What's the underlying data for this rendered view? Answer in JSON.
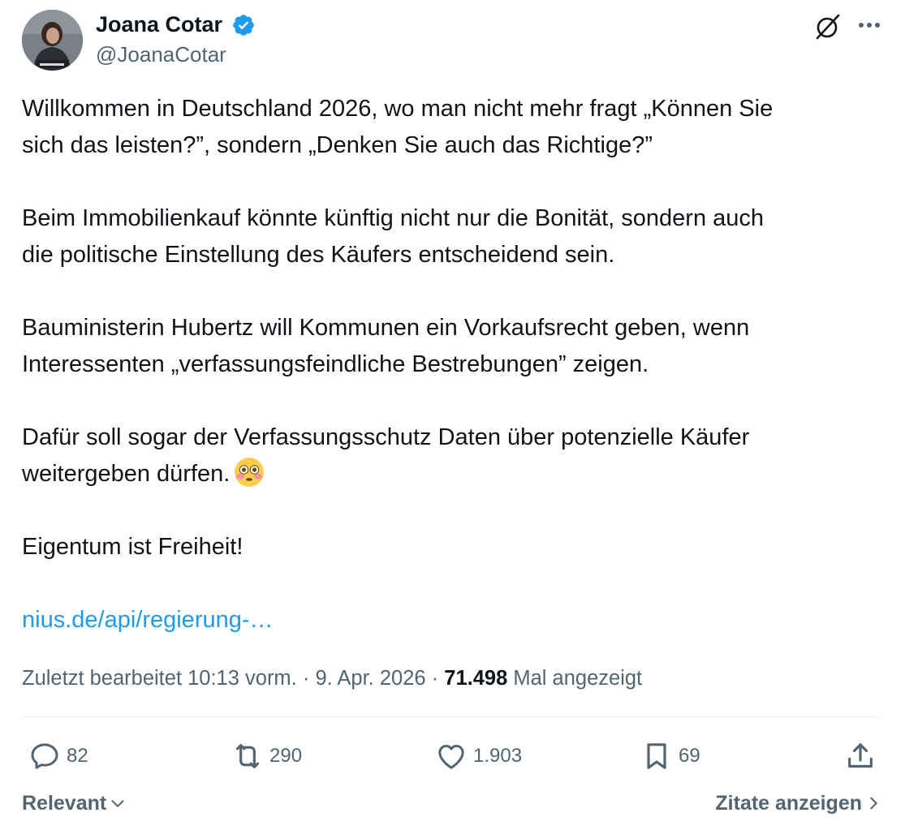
{
  "author": {
    "display_name": "Joana Cotar",
    "handle": "@JoanaCotar",
    "verified": true,
    "verified_color": "#1d9bf0"
  },
  "header_icons": [
    "grok-icon",
    "more-icon"
  ],
  "tweet": {
    "lines": [
      "Willkommen in Deutschland 2026, wo man nicht mehr fragt „Können Sie",
      "sich das leisten?”, sondern „Denken Sie auch das Richtige?”",
      "Beim Immobilienkauf könnte künftig nicht nur die Bonität, sondern auch",
      "die politische Einstellung des Käufers entscheidend sein.",
      "Bauministerin Hubertz will Kommunen ein Vorkaufsrecht geben, wenn",
      "Interessenten „verfassungsfeindliche Bestrebungen” zeigen.",
      "Dafür soll sogar der Verfassungsschutz Daten über potenzielle Käufer",
      "weitergeben dürfen.",
      "Eigentum ist Freiheit!"
    ],
    "emoji": "flushed-face",
    "link_text": "nius.de/api/regierung-…",
    "link_color": "#1d9bf0"
  },
  "meta": {
    "edited_time": "Zuletzt bearbeitet 10:13 vorm.",
    "separator": "·",
    "date": "9. Apr. 2026",
    "views_count": "71.498",
    "views_label": "Mal angezeigt"
  },
  "actions": {
    "replies": "82",
    "reposts": "290",
    "likes": "1.903",
    "bookmarks": "69"
  },
  "footer": {
    "sort_label": "Relevant",
    "quotes_label": "Zitate anzeigen"
  }
}
